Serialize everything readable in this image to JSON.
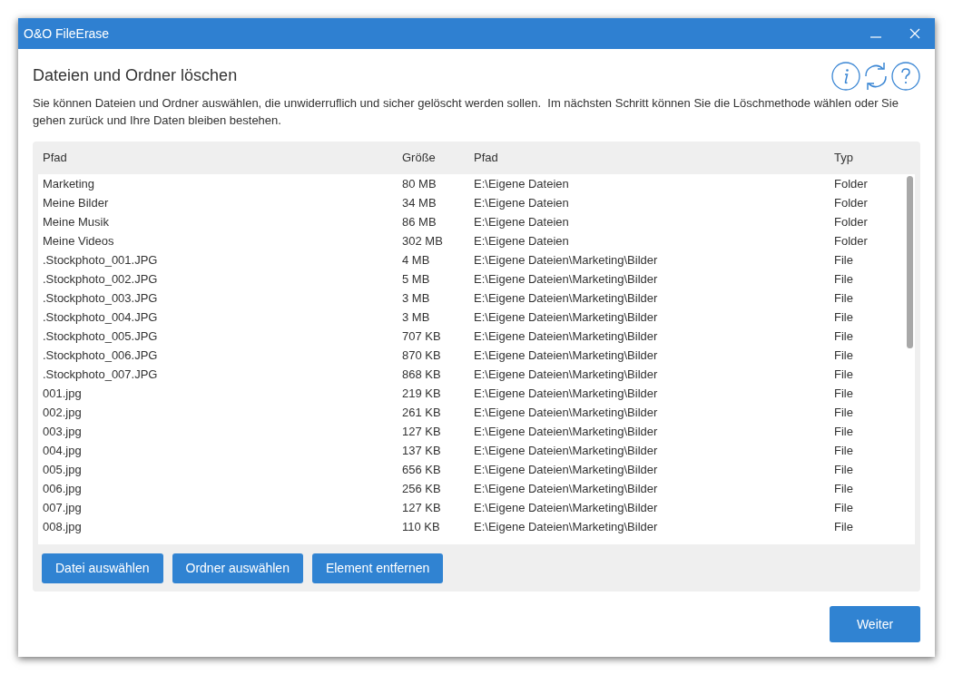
{
  "window": {
    "title": "O&O FileErase"
  },
  "heading": "Dateien und Ordner löschen",
  "description": "Sie können Dateien und Ordner auswählen, die unwiderruflich und sicher gelöscht werden sollen.  Im nächsten Schritt können Sie die Löschmethode wählen oder Sie gehen zurück und Ihre Daten bleiben bestehen.",
  "table": {
    "columns": [
      "Pfad",
      "Größe",
      "Pfad",
      "Typ"
    ],
    "rows": [
      [
        "Marketing",
        "80 MB",
        "E:\\Eigene Dateien",
        "Folder"
      ],
      [
        "Meine Bilder",
        "34 MB",
        "E:\\Eigene Dateien",
        "Folder"
      ],
      [
        "Meine Musik",
        "86 MB",
        "E:\\Eigene Dateien",
        "Folder"
      ],
      [
        "Meine Videos",
        "302 MB",
        "E:\\Eigene Dateien",
        "Folder"
      ],
      [
        ".Stockphoto_001.JPG",
        "4 MB",
        "E:\\Eigene Dateien\\Marketing\\Bilder",
        "File"
      ],
      [
        ".Stockphoto_002.JPG",
        "5 MB",
        "E:\\Eigene Dateien\\Marketing\\Bilder",
        "File"
      ],
      [
        ".Stockphoto_003.JPG",
        "3 MB",
        "E:\\Eigene Dateien\\Marketing\\Bilder",
        "File"
      ],
      [
        ".Stockphoto_004.JPG",
        "3 MB",
        "E:\\Eigene Dateien\\Marketing\\Bilder",
        "File"
      ],
      [
        ".Stockphoto_005.JPG",
        "707 KB",
        "E:\\Eigene Dateien\\Marketing\\Bilder",
        "File"
      ],
      [
        ".Stockphoto_006.JPG",
        "870 KB",
        "E:\\Eigene Dateien\\Marketing\\Bilder",
        "File"
      ],
      [
        ".Stockphoto_007.JPG",
        "868 KB",
        "E:\\Eigene Dateien\\Marketing\\Bilder",
        "File"
      ],
      [
        "001.jpg",
        "219 KB",
        "E:\\Eigene Dateien\\Marketing\\Bilder",
        "File"
      ],
      [
        "002.jpg",
        "261 KB",
        "E:\\Eigene Dateien\\Marketing\\Bilder",
        "File"
      ],
      [
        "003.jpg",
        "127 KB",
        "E:\\Eigene Dateien\\Marketing\\Bilder",
        "File"
      ],
      [
        "004.jpg",
        "137 KB",
        "E:\\Eigene Dateien\\Marketing\\Bilder",
        "File"
      ],
      [
        "005.jpg",
        "656 KB",
        "E:\\Eigene Dateien\\Marketing\\Bilder",
        "File"
      ],
      [
        "006.jpg",
        "256 KB",
        "E:\\Eigene Dateien\\Marketing\\Bilder",
        "File"
      ],
      [
        "007.jpg",
        "127 KB",
        "E:\\Eigene Dateien\\Marketing\\Bilder",
        "File"
      ],
      [
        "008.jpg",
        "110 KB",
        "E:\\Eigene Dateien\\Marketing\\Bilder",
        "File"
      ]
    ]
  },
  "panel_buttons": [
    "Datei auswählen",
    "Ordner auswählen",
    "Element entfernen"
  ],
  "next_button": "Weiter"
}
